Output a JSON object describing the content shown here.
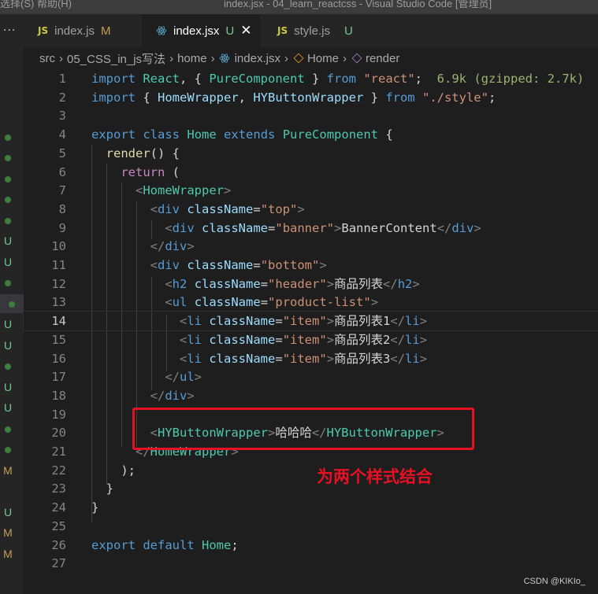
{
  "window": {
    "menu_text": "选择(S)   帮助(H)",
    "title": "index.jsx - 04_learn_reactcss - Visual Studio Code [管理员]"
  },
  "activity_bar": {
    "overflow_label": "..."
  },
  "tabs": [
    {
      "icon": "JS",
      "label": "index.js",
      "status": "M",
      "active": false
    },
    {
      "icon": "react-icon",
      "label": "index.jsx",
      "status": "U",
      "active": true,
      "close": "✕"
    },
    {
      "icon": "JS",
      "label": "style.js",
      "status": "U",
      "active": false
    }
  ],
  "breadcrumb": [
    "src",
    "05_CSS_in_js写法",
    "home",
    "index.jsx",
    "Home",
    "render"
  ],
  "gutter_status": [
    "",
    "",
    "",
    "dot",
    "dot",
    "dot",
    "dot",
    "dot",
    "U",
    "U",
    "dot",
    "dot",
    "U",
    "U",
    "dot",
    "U",
    "U",
    "dot",
    "dot",
    "M",
    "",
    "U",
    "M",
    "M"
  ],
  "editor": {
    "current_line": 14,
    "inlay_hint": "6.9k (gzipped: 2.7k)",
    "lines": [
      "import React, { PureComponent } from \"react\";",
      "import { HomeWrapper, HYButtonWrapper } from \"./style\";",
      "",
      "export class Home extends PureComponent {",
      "  render() {",
      "    return (",
      "      <HomeWrapper>",
      "        <div className=\"top\">",
      "          <div className=\"banner\">BannerContent</div>",
      "        </div>",
      "        <div className=\"bottom\">",
      "          <h2 className=\"header\">商品列表</h2>",
      "          <ul className=\"product-list\">",
      "            <li className=\"item\">商品列表1</li>",
      "            <li className=\"item\">商品列表2</li>",
      "            <li className=\"item\">商品列表3</li>",
      "          </ul>",
      "        </div>",
      "",
      "        <HYButtonWrapper>哈哈哈</HYButtonWrapper>",
      "      </HomeWrapper>",
      "    );",
      "  }",
      "}",
      "",
      "export default Home;",
      ""
    ]
  },
  "annotation": {
    "text": "为两个样式结合",
    "color": "#e81123"
  },
  "watermark": "CSDN @KIKIo_",
  "colors": {
    "editor_bg": "#1e1e1e",
    "keyword": "#569cd6",
    "control": "#c586c0",
    "class": "#4ec9b0",
    "string": "#ce9178",
    "attribute": "#9cdcfe"
  }
}
